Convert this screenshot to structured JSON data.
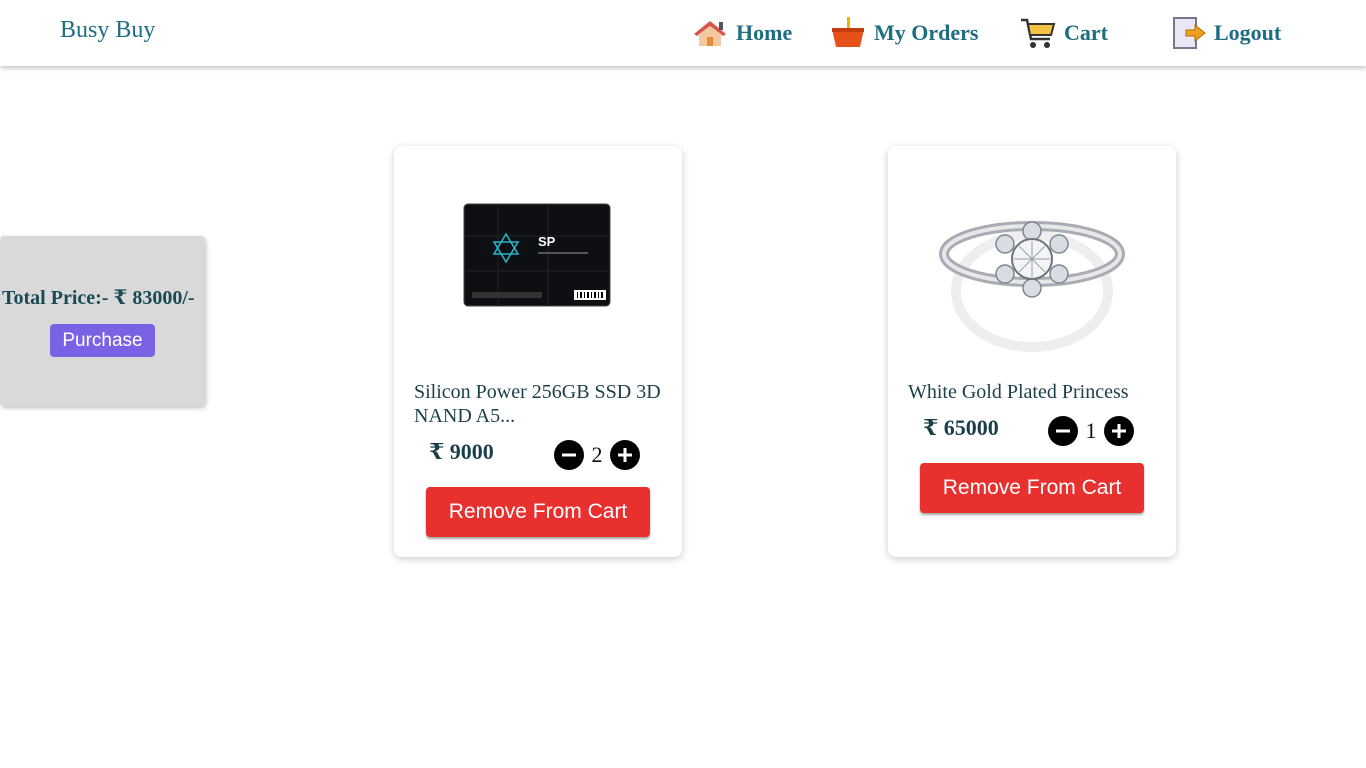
{
  "navbar": {
    "brand": "Busy Buy",
    "items": [
      {
        "label": "Home",
        "icon": "home-icon"
      },
      {
        "label": "My Orders",
        "icon": "basket-icon"
      },
      {
        "label": "Cart",
        "icon": "cart-icon"
      },
      {
        "label": "Logout",
        "icon": "logout-icon"
      }
    ]
  },
  "summary": {
    "total_label": "Total Price:- ₹ 83000/-",
    "purchase_label": "Purchase"
  },
  "cart": {
    "items": [
      {
        "title": "Silicon Power 256GB SSD 3D NAND A5...",
        "price": "₹ 9000",
        "quantity": "2",
        "remove_label": "Remove From Cart",
        "image": "ssd-image"
      },
      {
        "title": "White Gold Plated Princess",
        "price": "₹ 65000",
        "quantity": "1",
        "remove_label": "Remove From Cart",
        "image": "ring-image"
      }
    ]
  },
  "colors": {
    "brand": "#1f6d80",
    "purchase": "#7a62e5",
    "remove": "#e8302f",
    "panel": "#d9d9d9"
  }
}
